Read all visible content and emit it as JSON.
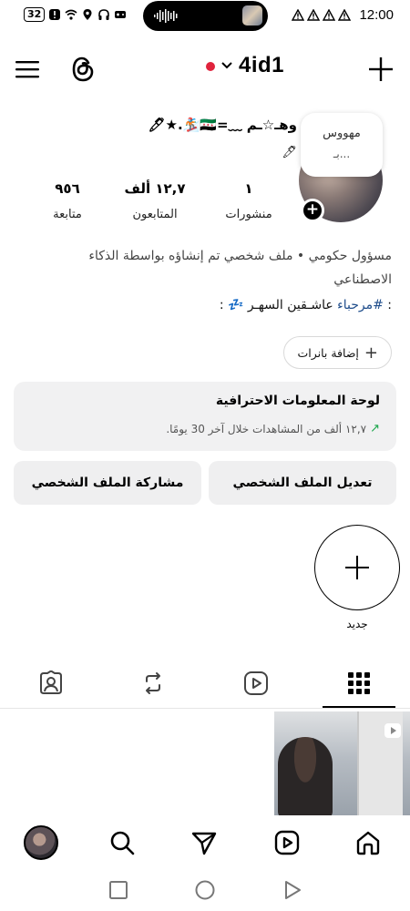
{
  "status_bar": {
    "battery": "32",
    "time": "12:00"
  },
  "header": {
    "username": "4id1"
  },
  "profile": {
    "display_name": "وهـ☆ـم ﹏=🇸🇾🏂.★🖊",
    "name_extra": "🖊",
    "note": {
      "line1": "مهووس",
      "line2": "بـ..."
    },
    "stats": [
      {
        "key": "posts",
        "value": "١",
        "label": "منشورات"
      },
      {
        "key": "followers",
        "value": "١٢,٧ ألف",
        "label": "المتابعون"
      },
      {
        "key": "following",
        "value": "٩٥٦",
        "label": "متابعة"
      }
    ],
    "bio": "مسؤول حكومي • ملف شخصي تم إنشاؤه بواسطة الذكاء الاصطناعي",
    "bio_line2_prefix": ": ",
    "bio_hashtag": "#مرحباء",
    "bio_line2_rest": " عاشـقين السهـر 💤 :",
    "add_banners": "إضافة بانرات"
  },
  "dashboard": {
    "title": "لوحة المعلومات الاحترافية",
    "subtitle": "١٢,٧ ألف من المشاهدات خلال آخر 30 يومًا."
  },
  "buttons": {
    "edit_profile": "تعديل الملف الشخصي",
    "share_profile": "مشاركة الملف الشخصي"
  },
  "highlights": {
    "new_label": "جديد"
  },
  "tabs": {
    "active": "grid",
    "items": [
      "grid-icon",
      "reels-icon",
      "reposts-icon",
      "tagged-icon"
    ]
  },
  "colors": {
    "accent_red": "#e0233c",
    "hashtag_blue": "#1f4d8b",
    "trend_green": "#1aa64a",
    "card_bg": "#f1f1f2"
  }
}
